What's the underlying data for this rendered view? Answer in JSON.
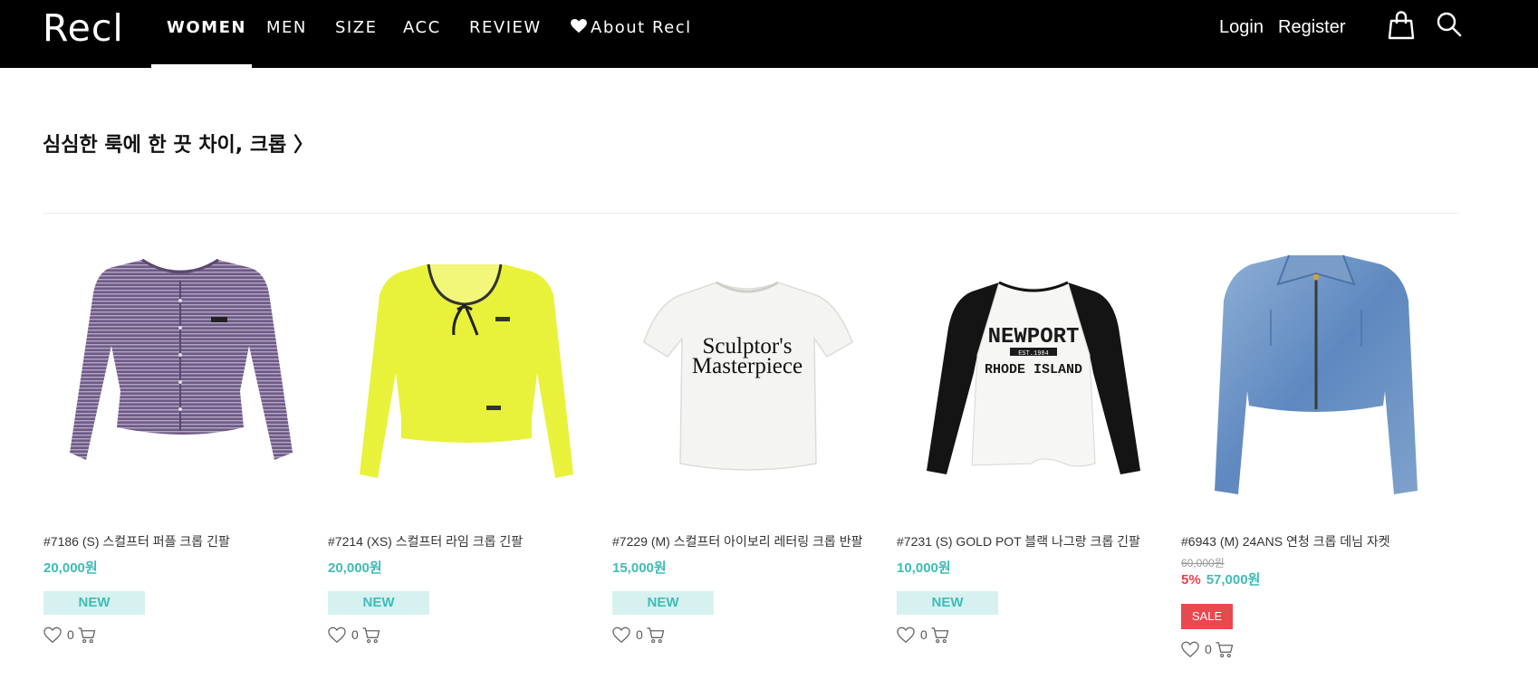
{
  "header": {
    "logo": "Recl",
    "nav": [
      "WOMEN",
      "MEN",
      "SIZE",
      "ACC",
      "REVIEW",
      "About Recl"
    ],
    "login": "Login",
    "register": "Register"
  },
  "section": {
    "title": "심심한 룩에 한 끗 차이, 크롭 〉"
  },
  "products": [
    {
      "name": "#7186 (S) 스컬프터 퍼플 크롭 긴팔",
      "price": "20,000원",
      "badge": "NEW",
      "likes": "0"
    },
    {
      "name": "#7214 (XS) 스컬프터 라임 크롭 긴팔",
      "price": "20,000원",
      "badge": "NEW",
      "likes": "0"
    },
    {
      "name": "#7229 (M) 스컬프터 아이보리 레터링 크롭 반팔",
      "price": "15,000원",
      "badge": "NEW",
      "likes": "0"
    },
    {
      "name": "#7231 (S) GOLD POT 블랙 나그랑 크롭 긴팔",
      "price": "10,000원",
      "badge": "NEW",
      "likes": "0"
    },
    {
      "name": "#6943 (M) 24ANS 연청 크롭 데님 자켓",
      "original_price": "60,000원",
      "discount": "5%",
      "price": "57,000원",
      "badge": "SALE",
      "likes": "0"
    }
  ],
  "print_text": {
    "tee_line1": "Sculptor's",
    "tee_line2": "Masterpiece",
    "raglan_line1": "NEWPORT",
    "raglan_line2": "EST.1984",
    "raglan_line3": "RHODE ISLAND"
  },
  "colors": {
    "header_bg": "#000000",
    "accent_teal": "#3dbcb7",
    "new_badge_bg": "#d6f1f0",
    "sale_red": "#e8494f"
  },
  "icons": [
    "heart-icon",
    "shopping-bag-icon",
    "search-icon",
    "like-heart-icon",
    "cart-icon"
  ]
}
